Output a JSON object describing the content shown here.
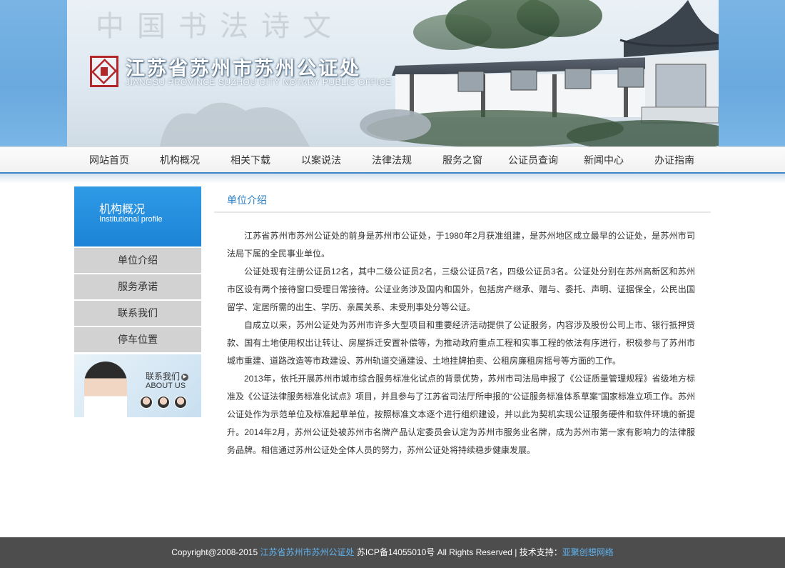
{
  "header": {
    "title": "江苏省苏州市苏州公证处",
    "subtitle": "JIANGSU PROVINCE SUZHOU CITY NOTARY PUBLIC OFFICE",
    "calligraphy": "中国书法诗文"
  },
  "nav": {
    "items": [
      "网站首页",
      "机构概况",
      "相关下载",
      "以案说法",
      "法律法规",
      "服务之窗",
      "公证员查询",
      "新闻中心",
      "办证指南"
    ]
  },
  "sidebar": {
    "title": "机构概况",
    "subtitle": "Institutional profile",
    "items": [
      "单位介绍",
      "服务承诺",
      "联系我们",
      "停车位置"
    ],
    "contact": {
      "title": "联系我们",
      "subtitle": "ABOUT US"
    }
  },
  "main": {
    "section_title": "单位介绍",
    "paragraphs": [
      "江苏省苏州市苏州公证处的前身是苏州市公证处，于1980年2月获准组建，是苏州地区成立最早的公证处，是苏州市司法局下属的全民事业单位。",
      "公证处现有注册公证员12名，其中二级公证员2名，三级公证员7名，四级公证员3名。公证处分别在苏州高新区和苏州市区设有两个接待窗口受理日常接待。公证业务涉及国内和国外，包括房产继承、赠与、委托、声明、证据保全，公民出国留学、定居所需的出生、学历、亲属关系、未受刑事处分等公证。",
      "自成立以来，苏州公证处为苏州市许多大型项目和重要经济活动提供了公证服务，内容涉及股份公司上市、银行抵押贷款、国有土地使用权出让转让、房屋拆迁安置补偿等，为推动政府重点工程和实事工程的依法有序进行，积极参与了苏州市城市重建、道路改造等市政建设、苏州轨道交通建设、土地挂牌拍卖、公租房廉租房摇号等方面的工作。",
      "2013年，依托开展苏州市城市综合服务标准化试点的背景优势，苏州市司法局申报了《公证质量管理规程》省级地方标准及《公证法律服务标准化试点》项目，并且参与了江苏省司法厅所申报的“公证服务标准体系草案”国家标准立项工作。苏州公证处作为示范单位及标准起草单位，按照标准文本逐个进行组织建设，并以此为契机实现公证服务硬件和软件环境的新提升。2014年2月，苏州公证处被苏州市名牌产品认定委员会认定为苏州市服务业名牌，成为苏州市第一家有影响力的法律服务品牌。相信通过苏州公证处全体人员的努力，苏州公证处将持续稳步健康发展。"
    ]
  },
  "footer": {
    "copyright": "Copyright@2008-2015",
    "org_link": "江苏省苏州市苏州公证处",
    "icp": "苏ICP备14055010号 All Rights Reserved",
    "separator": "|",
    "tech_label": "技术支持：",
    "tech_link": "亚聚创想网络"
  },
  "colors": {
    "accent": "#2a7fc4",
    "nav_border": "#3b87c7",
    "sidebar_head": "#1d83d6",
    "footer_bg": "#4d4d4d",
    "footer_link": "#5fb4f0",
    "logo_red": "#b3262a"
  },
  "icons": {
    "logo": "seal-logo-icon",
    "contact_arrow": "arrow-right-circle-icon"
  }
}
